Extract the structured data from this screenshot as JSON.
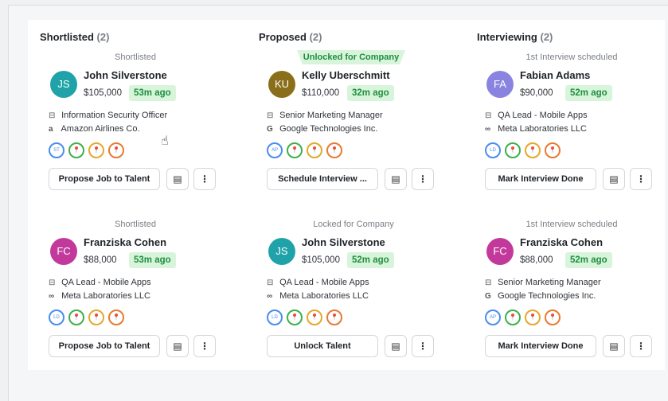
{
  "columns": [
    {
      "title": "Shortlisted",
      "count": "(2)",
      "cards": [
        {
          "status": "Shortlisted",
          "status_style": "plain",
          "initials": "JS",
          "avatar_color": "#1fa3a8",
          "name": "John Silverstone",
          "salary": "$105,000",
          "ago": "53m ago",
          "job": "Information Security Officer",
          "company": "Amazon Airlines Co.",
          "company_icon": "a",
          "chip0": "ST",
          "action": "Propose Job to Talent"
        },
        {
          "status": "Shortlisted",
          "status_style": "plain",
          "initials": "FC",
          "avatar_color": "#c2399b",
          "name": "Franziska Cohen",
          "salary": "$88,000",
          "ago": "53m ago",
          "job": "QA Lead - Mobile Apps",
          "company": "Meta Laboratories LLC",
          "company_icon": "∞",
          "chip0": "LD",
          "action": "Propose Job to Talent"
        }
      ]
    },
    {
      "title": "Proposed",
      "count": "(2)",
      "cards": [
        {
          "status": "Unlocked for Company",
          "status_style": "green",
          "initials": "KU",
          "avatar_color": "#8a6e1a",
          "name": "Kelly Uberschmitt",
          "salary": "$110,000",
          "ago": "32m ago",
          "job": "Senior Marketing Manager",
          "company": "Google Technologies Inc.",
          "company_icon": "G",
          "chip0": "AP",
          "action": "Schedule Interview ..."
        },
        {
          "status": "Locked for Company",
          "status_style": "plain",
          "initials": "JS",
          "avatar_color": "#1fa3a8",
          "name": "John Silverstone",
          "salary": "$105,000",
          "ago": "52m ago",
          "job": "QA Lead - Mobile Apps",
          "company": "Meta Laboratories LLC",
          "company_icon": "∞",
          "chip0": "LD",
          "action": "Unlock Talent"
        }
      ]
    },
    {
      "title": "Interviewing",
      "count": "(2)",
      "cards": [
        {
          "status": "1st Interview scheduled",
          "status_style": "plain",
          "initials": "FA",
          "avatar_color": "#8a84e0",
          "name": "Fabian Adams",
          "salary": "$90,000",
          "ago": "52m ago",
          "job": "QA Lead - Mobile Apps",
          "company": "Meta Laboratories LLC",
          "company_icon": "∞",
          "chip0": "LD",
          "action": "Mark Interview Done"
        },
        {
          "status": "1st Interview scheduled",
          "status_style": "plain",
          "initials": "FC",
          "avatar_color": "#c2399b",
          "name": "Franziska Cohen",
          "salary": "$88,000",
          "ago": "52m ago",
          "job": "Senior Marketing Manager",
          "company": "Google Technologies Inc.",
          "company_icon": "G",
          "chip0": "AP",
          "action": "Mark Interview Done"
        }
      ]
    }
  ],
  "icons": {
    "job": "briefcase-icon",
    "note": "notes-icon",
    "more": "more-vertical-icon",
    "chip": "location-pin-icon"
  },
  "more_glyph": "⋮",
  "note_glyph": "▤",
  "pin_glyph": "📍"
}
